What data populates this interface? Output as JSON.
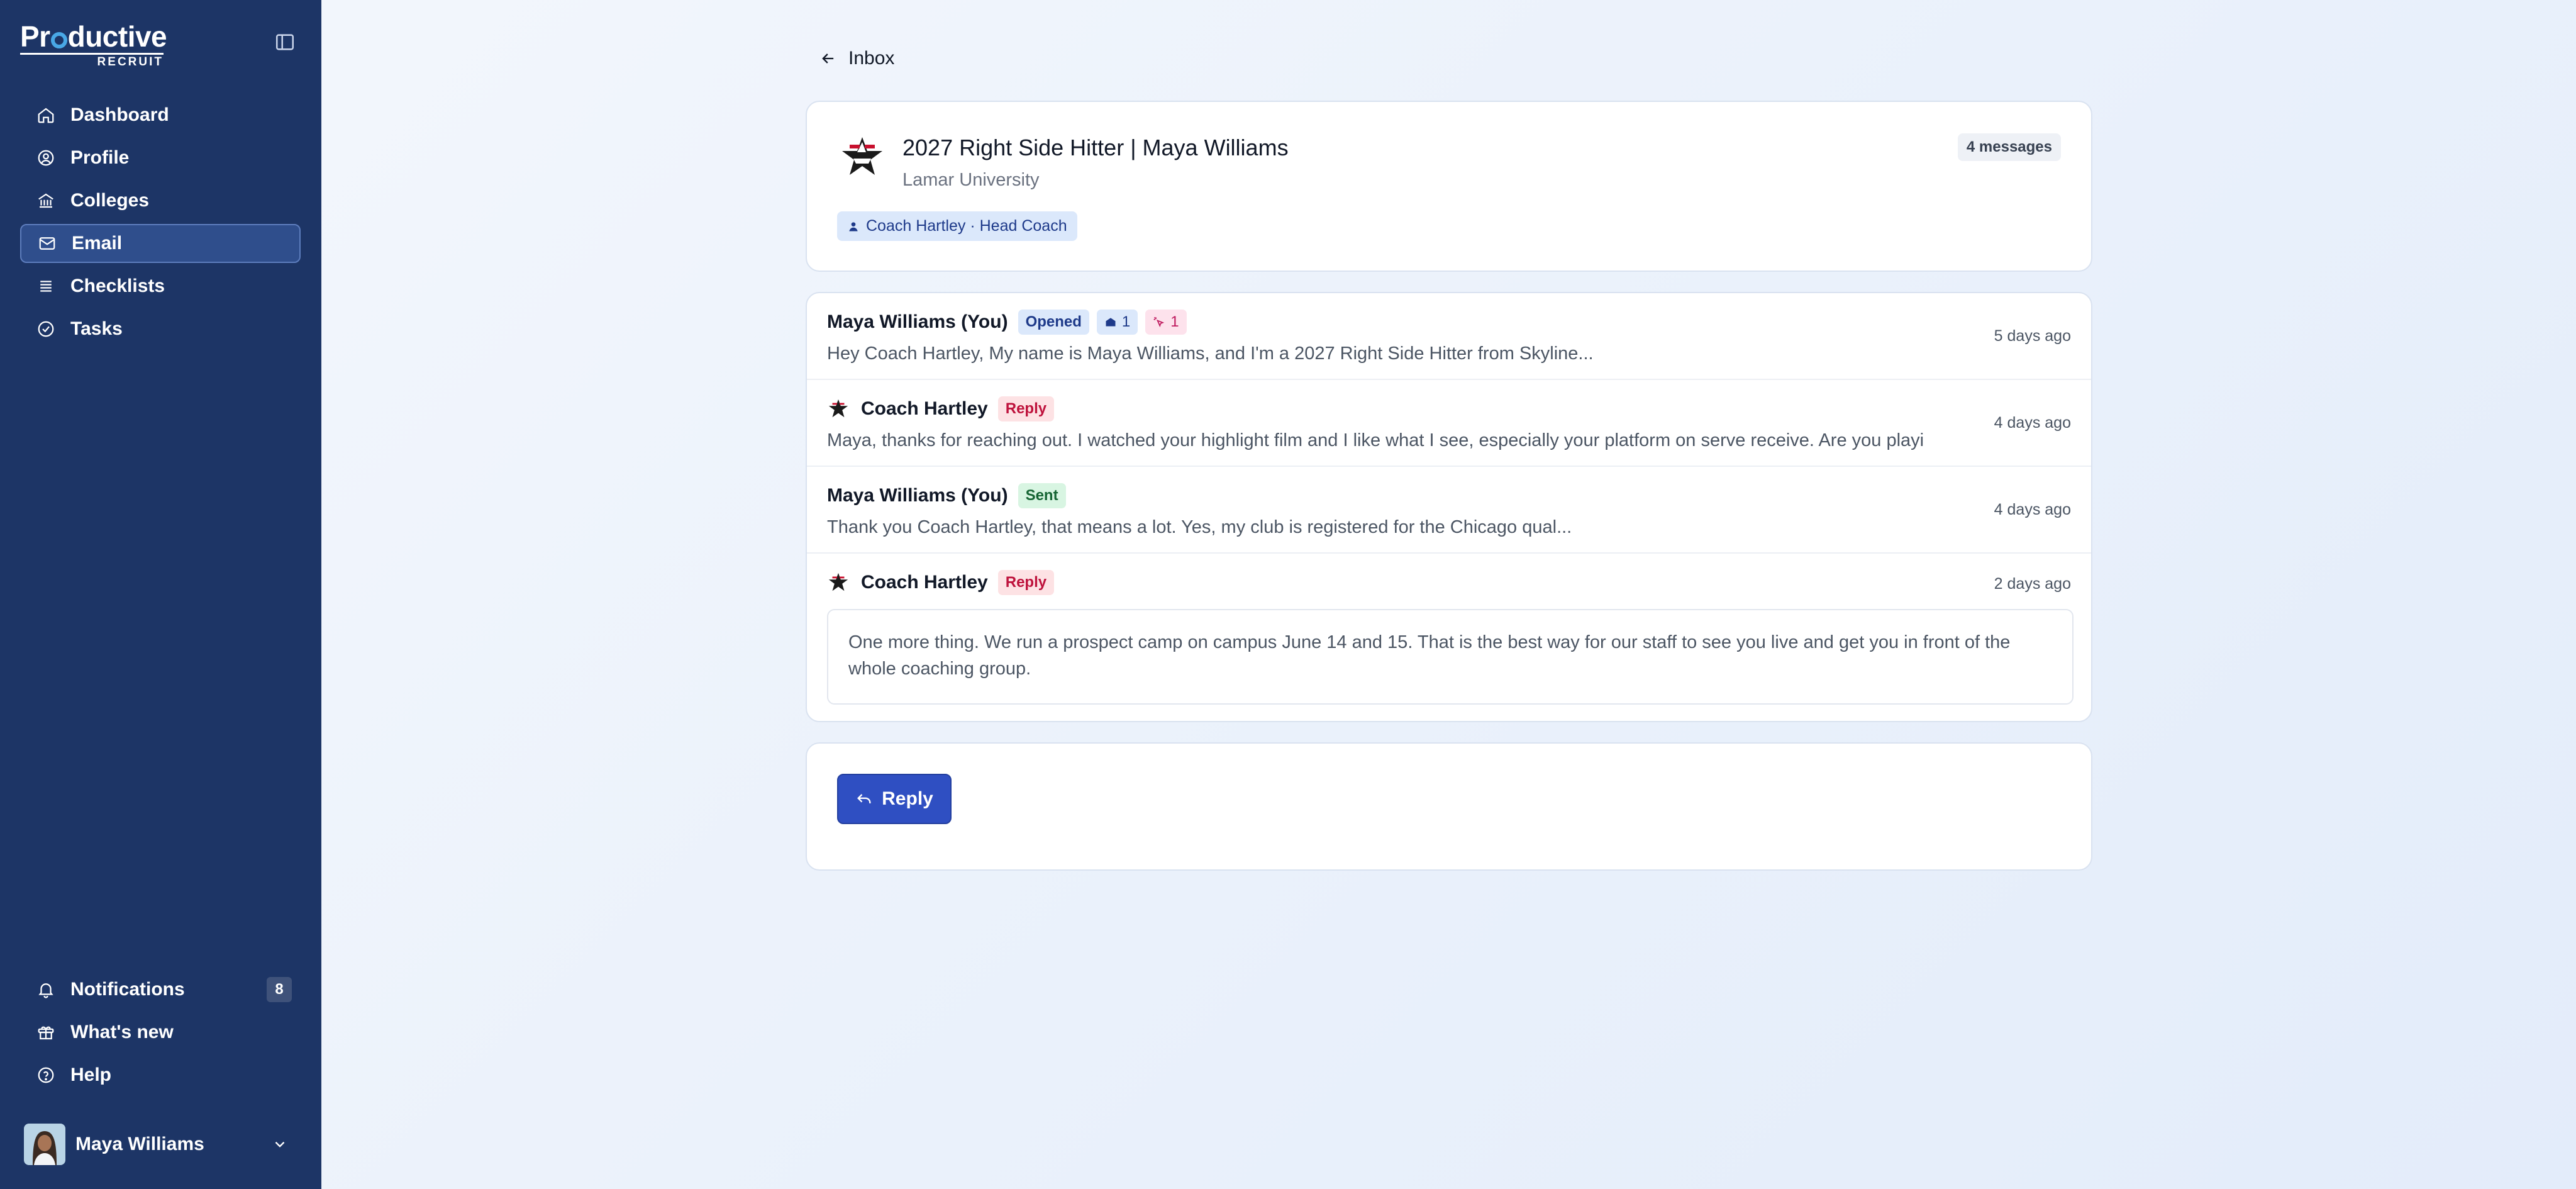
{
  "brand": {
    "name_top": "Productive",
    "name_bottom": "RECRUIT"
  },
  "sidebar": {
    "items": [
      {
        "label": "Dashboard",
        "icon": "home-icon"
      },
      {
        "label": "Profile",
        "icon": "user-circle-icon"
      },
      {
        "label": "Colleges",
        "icon": "building-icon"
      },
      {
        "label": "Email",
        "icon": "mail-icon",
        "active": true
      },
      {
        "label": "Checklists",
        "icon": "list-icon"
      },
      {
        "label": "Tasks",
        "icon": "check-circle-icon"
      }
    ],
    "bottom": [
      {
        "label": "Notifications",
        "icon": "bell-icon",
        "count": "8"
      },
      {
        "label": "What's new",
        "icon": "gift-icon"
      },
      {
        "label": "Help",
        "icon": "help-circle-icon"
      }
    ],
    "user": {
      "name": "Maya Williams"
    }
  },
  "back": {
    "label": "Inbox"
  },
  "thread": {
    "title": "2027 Right Side Hitter | Maya Williams",
    "school": "Lamar University",
    "message_count": "4 messages",
    "coach_chip": "Coach Hartley · Head Coach"
  },
  "messages": [
    {
      "sender": "Maya Williams (You)",
      "tag": "Opened",
      "opens": "1",
      "clicks": "1",
      "preview": "Hey Coach Hartley, My name is Maya Williams, and I'm a 2027 Right Side Hitter from Skyline...",
      "time": "5 days ago"
    },
    {
      "sender": "Coach Hartley",
      "tag": "Reply",
      "preview": "Maya, thanks for reaching out. I watched your highlight film and I like what I see, especially your platform on serve receive. Are you playi",
      "time": "4 days ago"
    },
    {
      "sender": "Maya Williams (You)",
      "tag": "Sent",
      "preview": "Thank you Coach Hartley, that means a lot. Yes, my club is registered for the Chicago qual...",
      "time": "4 days ago"
    },
    {
      "sender": "Coach Hartley",
      "tag": "Reply",
      "body": "One more thing. We run a prospect camp on campus June 14 and 15. That is the best way for our staff to see you live and get you in front of the whole coaching group.",
      "time": "2 days ago"
    }
  ],
  "reply_button": {
    "label": "Reply"
  }
}
